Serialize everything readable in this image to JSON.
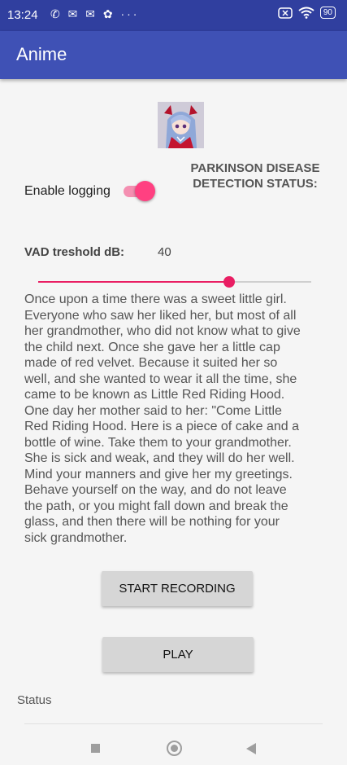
{
  "status_bar": {
    "time": "13:24",
    "left_icons": "✆ ✉ ✉ ✿ ···",
    "battery": "90",
    "icons": [
      "signal-x-icon",
      "wifi-icon",
      "battery-icon"
    ]
  },
  "app_bar": {
    "title": "Anime"
  },
  "parkinson_status": {
    "label": "PARKINSON DISEASE DETECTION STATUS:"
  },
  "logging": {
    "label": "Enable logging",
    "enabled": true
  },
  "vad": {
    "label": "VAD treshold dB:",
    "value": "40",
    "slider_fraction": 0.7
  },
  "story": {
    "text": "Once upon a time there was a sweet little girl. Everyone who saw her liked her, but most of all her grandmother, who did not know what to give the child next. Once she gave her a little cap made of red velvet. Because it suited her so well, and she wanted to wear it all the time, she came to be known as Little Red Riding Hood. One day her mother said to her: \"Come Little Red Riding Hood. Here is a piece of cake and a bottle of wine. Take them to your grandmother. She is sick and weak, and they will do her well. Mind your manners and give her my greetings. Behave yourself on the way, and do not leave the path, or you might fall down and break the glass, and then there will be nothing for your sick grandmother."
  },
  "buttons": {
    "start_recording": "START RECORDING",
    "play": "PLAY"
  },
  "status": {
    "label": "Status"
  },
  "colors": {
    "primary": "#3f51b5",
    "primary_dark": "#303f9f",
    "accent": "#ff4081",
    "slider": "#e91e63"
  }
}
